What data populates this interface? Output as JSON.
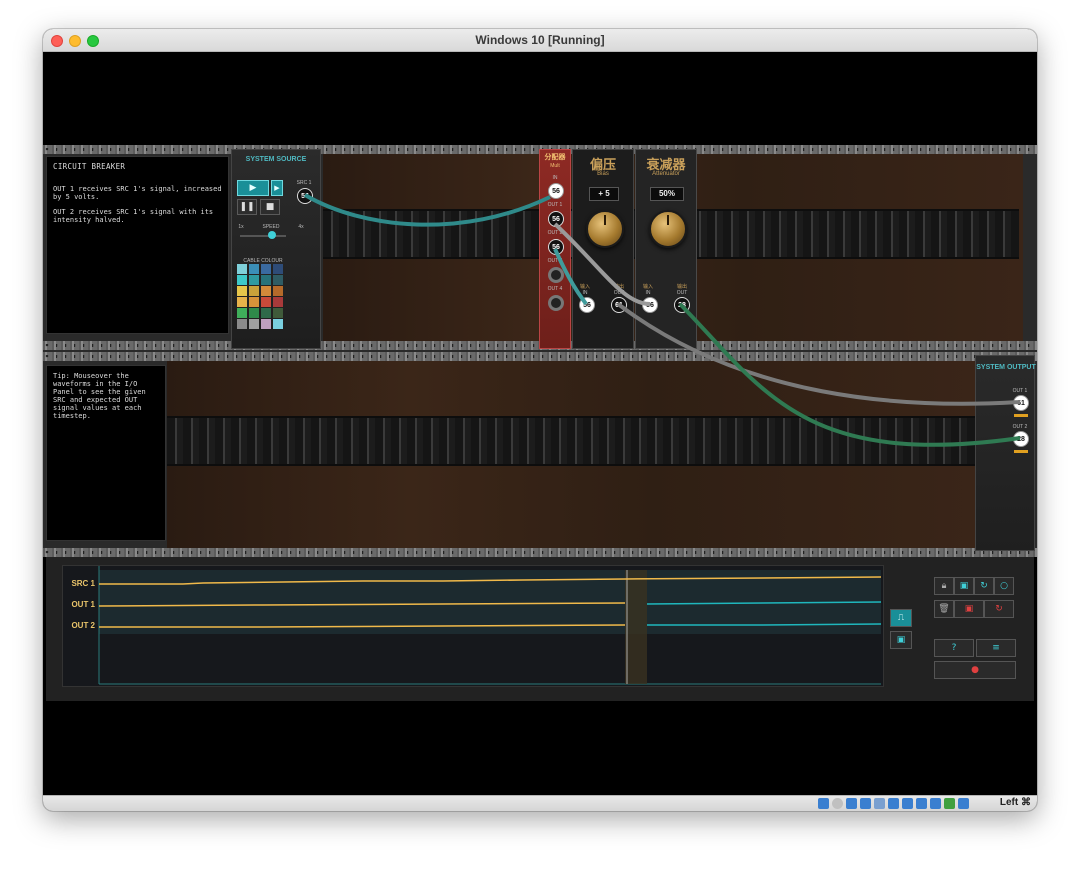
{
  "window": {
    "title": "Windows 10 [Running]"
  },
  "statusbar": {
    "host_key": "Left ⌘"
  },
  "instructions": {
    "title": "CIRCUIT BREAKER",
    "lines": [
      "OUT 1 receives SRC 1's signal, increased by 5 volts.",
      "OUT 2 receives SRC 1's signal with its intensity halved."
    ]
  },
  "tip": {
    "text": "Tip: Mouseover the waveforms in the I/O Panel to see the given SRC and expected OUT signal values at each timestep."
  },
  "system_source": {
    "title": "SYSTEM SOURCE",
    "src_label": "SRC 1",
    "src_value": "56",
    "speed_label": "SPEED",
    "speed_min": "1x",
    "speed_max": "4x",
    "cable_colour_label": "CABLE COLOUR",
    "palette": [
      "#7fd0da",
      "#3b8fb8",
      "#3a6aa0",
      "#2e4c78",
      "#3ec9c9",
      "#2f9aa0",
      "#27727a",
      "#2f5c64",
      "#e7c64a",
      "#c9a23a",
      "#d28a3a",
      "#b56a2a",
      "#e7b24a",
      "#d6923a",
      "#c84a3a",
      "#a83a3a",
      "#3fae5a",
      "#2f8a4a",
      "#2f6a4a",
      "#3f5a3a",
      "#8a8a8a",
      "#a0a0a0",
      "#c0a0c0",
      "#7ad0e0"
    ]
  },
  "mult": {
    "cn": "分配器",
    "en": "Mult",
    "in_label": "IN",
    "out_labels": [
      "OUT 1",
      "OUT 2",
      "OUT 3",
      "OUT 4"
    ],
    "in_value": "56",
    "out_values": [
      "56",
      "56",
      "",
      ""
    ]
  },
  "bias": {
    "cn": "偏压",
    "en": "Bias",
    "readout": "+ 5",
    "in_label_cn": "输入",
    "in_label": "IN",
    "out_label_cn": "输出",
    "out_label": "OUT",
    "in_value": "56",
    "out_value": "61"
  },
  "attenuator": {
    "cn": "衰减器",
    "en": "Attenuator",
    "readout": "50%",
    "in_label_cn": "输入",
    "in_label": "IN",
    "out_label_cn": "输出",
    "out_label": "OUT",
    "in_value": "56",
    "out_value": "28"
  },
  "system_output": {
    "title": "SYSTEM OUTPUT",
    "out1_label": "OUT 1",
    "out1_value": "61",
    "out2_label": "OUT 2",
    "out2_value": "28"
  },
  "io_panel": {
    "rows": [
      "SRC 1",
      "OUT 1",
      "OUT 2"
    ]
  },
  "colors": {
    "teal": "#1fb7bd",
    "yellow": "#f0b94a",
    "cable_teal": "#2f8a8a",
    "cable_gray": "#8a8a8a",
    "cable_green": "#2f7a52"
  }
}
